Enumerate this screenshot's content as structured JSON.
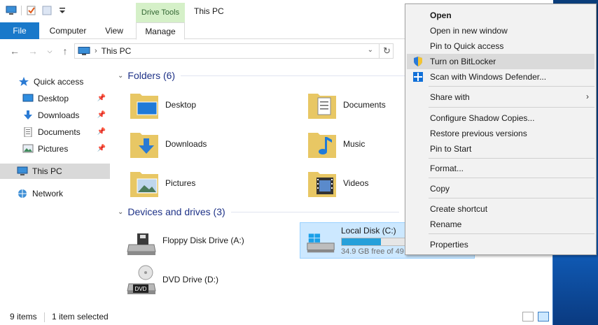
{
  "window": {
    "title": "This PC",
    "contextual_tab": "Drive Tools"
  },
  "ribbon": {
    "tabs": [
      {
        "label": "File"
      },
      {
        "label": "Computer"
      },
      {
        "label": "View"
      },
      {
        "label": "Manage"
      }
    ]
  },
  "address": {
    "path": "This PC"
  },
  "nav": {
    "quick_access": "Quick access",
    "items": [
      {
        "label": "Desktop",
        "icon": "desktop-icon"
      },
      {
        "label": "Downloads",
        "icon": "downloads-icon"
      },
      {
        "label": "Documents",
        "icon": "documents-icon"
      },
      {
        "label": "Pictures",
        "icon": "pictures-icon"
      }
    ],
    "this_pc": "This PC",
    "network": "Network"
  },
  "folders": {
    "header": "Folders (6)",
    "items": [
      {
        "label": "Desktop"
      },
      {
        "label": "Documents"
      },
      {
        "label": "Downloads"
      },
      {
        "label": "Music"
      },
      {
        "label": "Pictures"
      },
      {
        "label": "Videos"
      }
    ]
  },
  "drives": {
    "header": "Devices and drives (3)",
    "items": [
      {
        "label": "Floppy Disk Drive (A:)"
      },
      {
        "label": "Local Disk (C:)",
        "sub": "34.9 GB free of 49",
        "used_fraction": 0.3
      },
      {
        "label": "DVD Drive (D:)"
      }
    ]
  },
  "status": {
    "count": "9 items",
    "selected": "1 item selected"
  },
  "context_menu": {
    "items": [
      {
        "label": "Open"
      },
      {
        "label": "Open in new window"
      },
      {
        "label": "Pin to Quick access"
      },
      {
        "label": "Turn on BitLocker"
      },
      {
        "label": "Scan with Windows Defender..."
      },
      {
        "label": "Share with"
      },
      {
        "label": "Configure Shadow Copies..."
      },
      {
        "label": "Restore previous versions"
      },
      {
        "label": "Pin to Start"
      },
      {
        "label": "Format..."
      },
      {
        "label": "Copy"
      },
      {
        "label": "Create shortcut"
      },
      {
        "label": "Rename"
      },
      {
        "label": "Properties"
      }
    ]
  },
  "colors": {
    "accent": "#1979ca",
    "group_header": "#1e3287",
    "selection": "#cce8ff",
    "drive_fill": "#26a0da",
    "contextual_tab_bg": "#d5f0c8"
  }
}
